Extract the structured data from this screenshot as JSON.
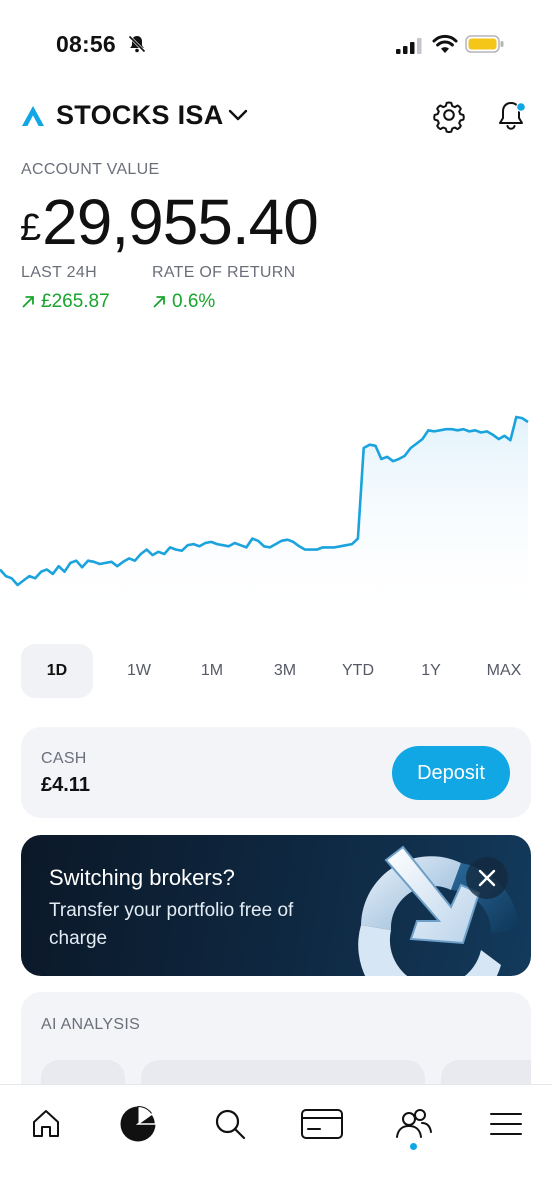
{
  "status_bar": {
    "time": "08:56"
  },
  "header": {
    "account_name": "STOCKS ISA",
    "icons": [
      "brand-logo-icon",
      "chevron-down-icon",
      "gear-icon",
      "bell-icon"
    ]
  },
  "account": {
    "label": "ACCOUNT VALUE",
    "currency": "£",
    "value": "29,955.40"
  },
  "stats": {
    "last24_label": "LAST 24H",
    "last24_value": "£265.87",
    "ror_label": "RATE OF RETURN",
    "ror_value": "0.6%",
    "positive_color": "#19a52d"
  },
  "chart_data": {
    "type": "area",
    "title": "",
    "xlabel": "",
    "ylabel": "",
    "grid": false,
    "y": [
      28620,
      28560,
      28540,
      28480,
      28520,
      28560,
      28540,
      28600,
      28620,
      28580,
      28650,
      28600,
      28680,
      28700,
      28640,
      28700,
      28690,
      28670,
      28680,
      28690,
      28650,
      28690,
      28720,
      28700,
      28760,
      28800,
      28750,
      28780,
      28760,
      28820,
      28800,
      28790,
      28840,
      28850,
      28830,
      28860,
      28870,
      28850,
      28840,
      28830,
      28860,
      28840,
      28820,
      28900,
      28880,
      28830,
      28820,
      28850,
      28880,
      28890,
      28870,
      28830,
      28800,
      28800,
      28800,
      28820,
      28820,
      28820,
      28830,
      28840,
      28850,
      28900,
      29720,
      29750,
      29740,
      29620,
      29640,
      29600,
      29620,
      29650,
      29720,
      29760,
      29800,
      29880,
      29870,
      29880,
      29890,
      29890,
      29880,
      29890,
      29870,
      29880,
      29860,
      29870,
      29840,
      29800,
      29830,
      29790,
      30000,
      29990,
      29955
    ],
    "colors": {
      "line": "#1aa3dd",
      "fill": "#eaf6fc"
    }
  },
  "ranges": {
    "items": [
      "1D",
      "1W",
      "1M",
      "3M",
      "YTD",
      "1Y",
      "MAX"
    ],
    "active": "1D"
  },
  "cash": {
    "label": "CASH",
    "value": "£4.11",
    "deposit_label": "Deposit",
    "accent": "#11a6e4"
  },
  "promo": {
    "title": "Switching brokers?",
    "subtitle": "Transfer your portfolio free of charge"
  },
  "ai": {
    "label": "AI ANALYSIS"
  },
  "bottom_nav": {
    "items": [
      "home-icon",
      "portfolio-pie-icon",
      "search-icon",
      "card-icon",
      "community-icon",
      "menu-icon"
    ],
    "active": "portfolio-pie-icon"
  }
}
